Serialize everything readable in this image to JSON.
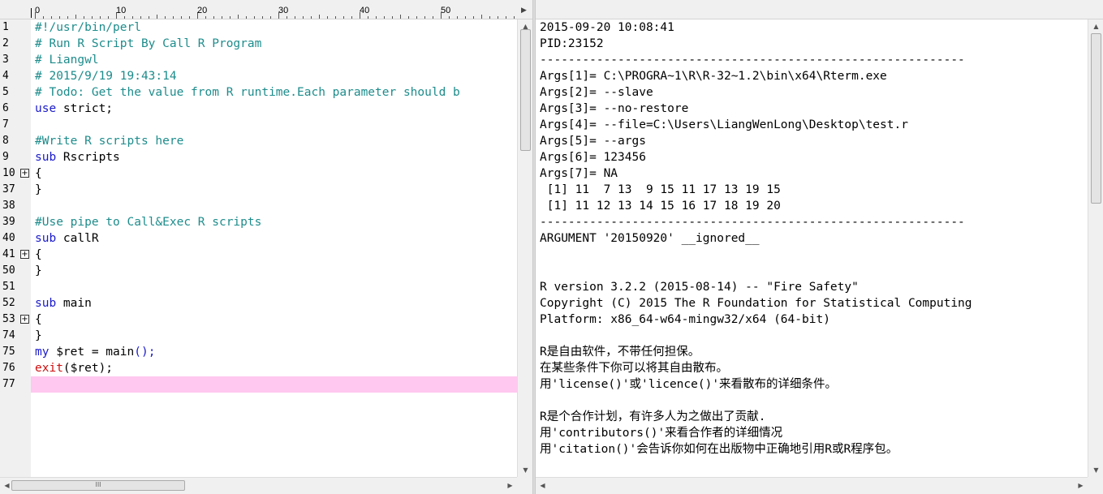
{
  "editor": {
    "ruler": {
      "labels": [
        "0",
        "10",
        "20",
        "30",
        "40",
        "50"
      ]
    },
    "lines": [
      {
        "num": "1",
        "fold": "",
        "segments": [
          {
            "text": "#!/usr/bin/perl",
            "style": "cm"
          }
        ]
      },
      {
        "num": "2",
        "fold": "",
        "segments": [
          {
            "text": "# Run R Script By Call R Program",
            "style": "cm"
          }
        ]
      },
      {
        "num": "3",
        "fold": "",
        "segments": [
          {
            "text": "# Liangwl",
            "style": "cm"
          }
        ]
      },
      {
        "num": "4",
        "fold": "",
        "segments": [
          {
            "text": "# 2015/9/19 19:43:14",
            "style": "cm"
          }
        ]
      },
      {
        "num": "5",
        "fold": "",
        "segments": [
          {
            "text": "# Todo: Get the value from R runtime.Each parameter should b",
            "style": "cm"
          }
        ]
      },
      {
        "num": "6",
        "fold": "",
        "segments": [
          {
            "text": "use",
            "style": "kw"
          },
          {
            "text": " strict;",
            "style": "blk"
          }
        ]
      },
      {
        "num": "7",
        "fold": "",
        "segments": []
      },
      {
        "num": "8",
        "fold": "",
        "segments": [
          {
            "text": "#Write R scripts here",
            "style": "cm"
          }
        ]
      },
      {
        "num": "9",
        "fold": "",
        "segments": [
          {
            "text": "sub",
            "style": "kw"
          },
          {
            "text": " Rscripts",
            "style": "blk"
          }
        ]
      },
      {
        "num": "10",
        "fold": "+",
        "segments": [
          {
            "text": "{",
            "style": "blk"
          }
        ]
      },
      {
        "num": "37",
        "fold": "",
        "segments": [
          {
            "text": "}",
            "style": "blk"
          }
        ]
      },
      {
        "num": "38",
        "fold": "",
        "segments": []
      },
      {
        "num": "39",
        "fold": "",
        "segments": [
          {
            "text": "#Use pipe to Call&Exec R scripts",
            "style": "cm"
          }
        ]
      },
      {
        "num": "40",
        "fold": "",
        "segments": [
          {
            "text": "sub",
            "style": "kw"
          },
          {
            "text": " callR",
            "style": "blk"
          }
        ]
      },
      {
        "num": "41",
        "fold": "+",
        "segments": [
          {
            "text": "{",
            "style": "blk"
          }
        ]
      },
      {
        "num": "50",
        "fold": "",
        "segments": [
          {
            "text": "}",
            "style": "blk"
          }
        ]
      },
      {
        "num": "51",
        "fold": "",
        "segments": []
      },
      {
        "num": "52",
        "fold": "",
        "segments": [
          {
            "text": "sub",
            "style": "kw"
          },
          {
            "text": " main",
            "style": "blk"
          }
        ]
      },
      {
        "num": "53",
        "fold": "+",
        "segments": [
          {
            "text": "{",
            "style": "blk"
          }
        ]
      },
      {
        "num": "74",
        "fold": "",
        "segments": [
          {
            "text": "}",
            "style": "blk"
          }
        ]
      },
      {
        "num": "75",
        "fold": "",
        "segments": [
          {
            "text": "my",
            "style": "kw"
          },
          {
            "text": " $ret = main",
            "style": "blk"
          },
          {
            "text": "();",
            "style": "kw"
          }
        ]
      },
      {
        "num": "76",
        "fold": "",
        "segments": [
          {
            "text": "exit",
            "style": "red"
          },
          {
            "text": "($ret);",
            "style": "blk"
          }
        ]
      },
      {
        "num": "77",
        "fold": "",
        "segments": []
      }
    ]
  },
  "output": {
    "lines": [
      "2015-09-20 10:08:41",
      "PID:23152",
      "------------------------------------------------------------",
      "Args[1]= C:\\PROGRA~1\\R\\R-32~1.2\\bin\\x64\\Rterm.exe",
      "Args[2]= --slave",
      "Args[3]= --no-restore",
      "Args[4]= --file=C:\\Users\\LiangWenLong\\Desktop\\test.r",
      "Args[5]= --args",
      "Args[6]= 123456",
      "Args[7]= NA",
      " [1] 11  7 13  9 15 11 17 13 19 15",
      " [1] 11 12 13 14 15 16 17 18 19 20",
      "------------------------------------------------------------",
      "ARGUMENT '20150920' __ignored__",
      "",
      "",
      "R version 3.2.2 (2015-08-14) -- \"Fire Safety\"",
      "Copyright (C) 2015 The R Foundation for Statistical Computing",
      "Platform: x86_64-w64-mingw32/x64 (64-bit)",
      "",
      "R是自由软件，不带任何担保。",
      "在某些条件下你可以将其自由散布。",
      "用'license()'或'licence()'来看散布的详细条件。",
      "",
      "R是个合作计划，有许多人为之做出了贡献.",
      "用'contributors()'来看合作者的详细情况",
      "用'citation()'会告诉你如何在出版物中正确地引用R或R程序包。"
    ]
  },
  "scrollbars": {
    "h_thumb_grip": "III"
  }
}
